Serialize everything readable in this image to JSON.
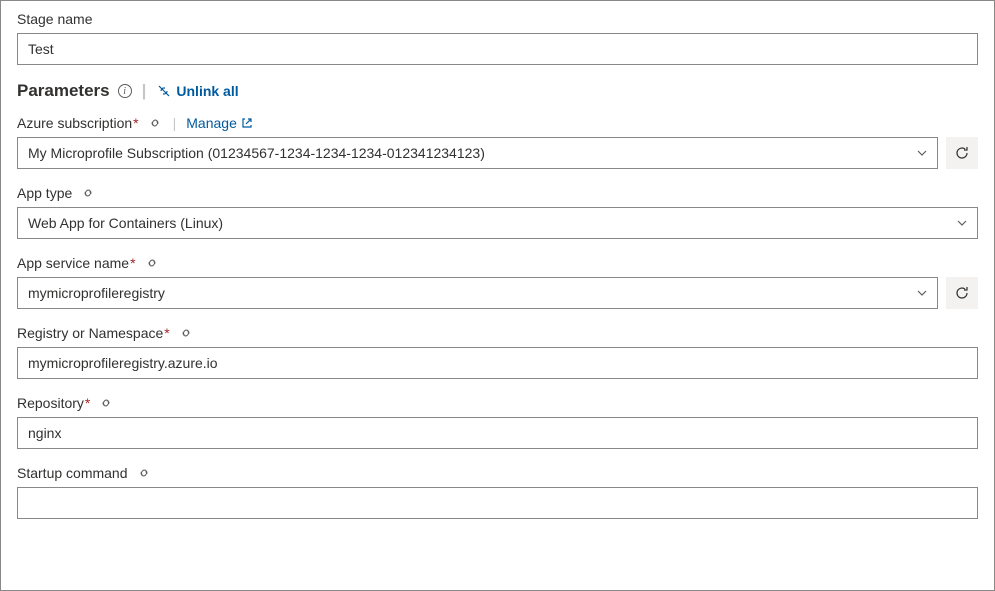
{
  "stage_name": {
    "label": "Stage name",
    "value": "Test"
  },
  "parameters": {
    "heading": "Parameters",
    "unlink_all_label": "Unlink all"
  },
  "azure_subscription": {
    "label": "Azure subscription",
    "required_marker": "*",
    "manage_label": "Manage",
    "value": "My Microprofile Subscription (01234567-1234-1234-1234-012341234123)"
  },
  "app_type": {
    "label": "App type",
    "value": "Web App for Containers (Linux)"
  },
  "app_service_name": {
    "label": "App service name",
    "required_marker": "*",
    "value": "mymicroprofileregistry"
  },
  "registry_namespace": {
    "label": "Registry or Namespace",
    "required_marker": "*",
    "value": "mymicroprofileregistry.azure.io"
  },
  "repository": {
    "label": "Repository",
    "required_marker": "*",
    "value": "nginx"
  },
  "startup_command": {
    "label": "Startup command",
    "value": ""
  }
}
